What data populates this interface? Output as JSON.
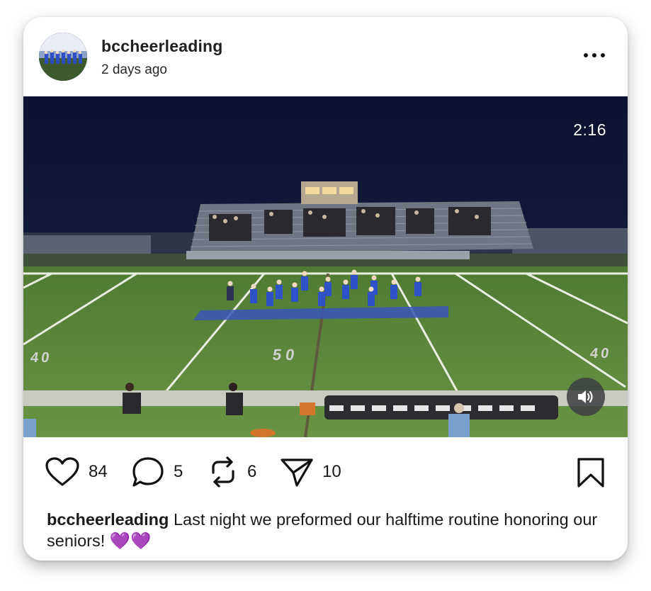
{
  "post": {
    "username": "bccheerleading",
    "timestamp": "2 days ago",
    "more_icon": "more-horizontal-icon"
  },
  "video": {
    "duration": "2:16",
    "sound_icon": "speaker-icon",
    "field_numbers": {
      "left": "40",
      "center": "50",
      "right": "40"
    }
  },
  "actions": {
    "likes": "84",
    "comments": "5",
    "reposts": "6",
    "shares": "10"
  },
  "caption": {
    "username": "bccheerleading",
    "text": "Last night we preformed our halftime routine honoring our seniors! 💜💜"
  },
  "colors": {
    "accent": "#111111",
    "field_green": "#5f8a3e",
    "sky": "#0f1631",
    "uniform_blue": "#2f52c9"
  }
}
